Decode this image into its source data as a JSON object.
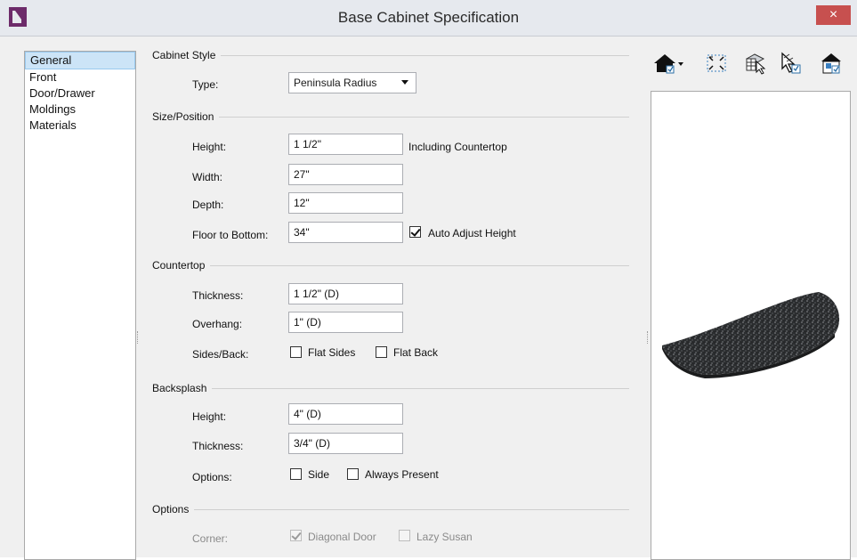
{
  "window": {
    "title": "Base Cabinet Specification",
    "close_glyph": "×"
  },
  "nav": {
    "items": [
      "General",
      "Front",
      "Door/Drawer",
      "Moldings",
      "Materials"
    ],
    "selected": "General"
  },
  "cabinet_style": {
    "group": "Cabinet Style",
    "type_label": "Type:",
    "type_value": "Peninsula Radius"
  },
  "size_position": {
    "group": "Size/Position",
    "height_label": "Height:",
    "height_value": "1 1/2\"",
    "height_note": "Including Countertop",
    "width_label": "Width:",
    "width_value": "27\"",
    "depth_label": "Depth:",
    "depth_value": "12\"",
    "floor_label": "Floor to Bottom:",
    "floor_value": "34\"",
    "auto_adjust_label": "Auto Adjust Height",
    "auto_adjust_checked": true
  },
  "countertop": {
    "group": "Countertop",
    "thickness_label": "Thickness:",
    "thickness_value": "1 1/2\" (D)",
    "overhang_label": "Overhang:",
    "overhang_value": "1\" (D)",
    "sides_label": "Sides/Back:",
    "flat_sides_label": "Flat Sides",
    "flat_sides_checked": false,
    "flat_back_label": "Flat Back",
    "flat_back_checked": false
  },
  "backsplash": {
    "group": "Backsplash",
    "height_label": "Height:",
    "height_value": "4\" (D)",
    "thickness_label": "Thickness:",
    "thickness_value": "3/4\" (D)",
    "options_label": "Options:",
    "side_label": "Side",
    "side_checked": false,
    "always_label": "Always Present",
    "always_checked": false
  },
  "options": {
    "group": "Options",
    "corner_label": "Corner:",
    "diagonal_label": "Diagonal Door",
    "diagonal_checked": true,
    "lazy_label": "Lazy Susan",
    "lazy_checked": false
  },
  "toolbar_icons": [
    "camera-view-icon",
    "fill-window-icon",
    "select-objects-icon",
    "cursor-select-icon",
    "home-view-icon"
  ],
  "colors": {
    "accent_select": "#cce4f7",
    "close": "#c7504f",
    "logo": "#6d2b6a"
  }
}
